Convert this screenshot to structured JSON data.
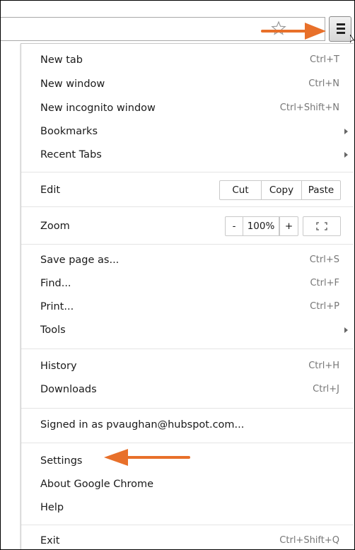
{
  "toolbar": {
    "star_icon": "star-icon",
    "menu_icon": "hamburger-menu-icon"
  },
  "menu": {
    "new_tab": {
      "label": "New tab",
      "shortcut": "Ctrl+T"
    },
    "new_window": {
      "label": "New window",
      "shortcut": "Ctrl+N"
    },
    "new_incognito": {
      "label": "New incognito window",
      "shortcut": "Ctrl+Shift+N"
    },
    "bookmarks": {
      "label": "Bookmarks"
    },
    "recent_tabs": {
      "label": "Recent Tabs"
    },
    "edit": {
      "label": "Edit",
      "cut": "Cut",
      "copy": "Copy",
      "paste": "Paste"
    },
    "zoom": {
      "label": "Zoom",
      "minus": "-",
      "value": "100%",
      "plus": "+"
    },
    "save_page": {
      "label": "Save page as...",
      "shortcut": "Ctrl+S"
    },
    "find": {
      "label": "Find...",
      "shortcut": "Ctrl+F"
    },
    "print": {
      "label": "Print...",
      "shortcut": "Ctrl+P"
    },
    "tools": {
      "label": "Tools"
    },
    "history": {
      "label": "History",
      "shortcut": "Ctrl+H"
    },
    "downloads": {
      "label": "Downloads",
      "shortcut": "Ctrl+J"
    },
    "signed_in": {
      "label": "Signed in as pvaughan@hubspot.com..."
    },
    "settings": {
      "label": "Settings"
    },
    "about": {
      "label": "About Google Chrome"
    },
    "help": {
      "label": "Help"
    },
    "exit": {
      "label": "Exit",
      "shortcut": "Ctrl+Shift+Q"
    }
  },
  "annotations": {
    "arrow_color": "#e8702a"
  }
}
